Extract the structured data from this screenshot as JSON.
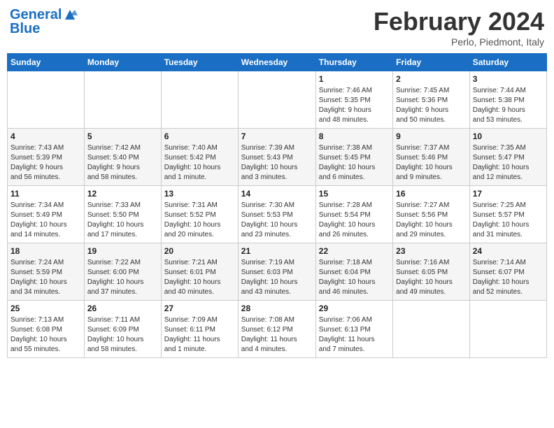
{
  "header": {
    "logo_line1": "General",
    "logo_line2": "Blue",
    "month_title": "February 2024",
    "location": "Perlo, Piedmont, Italy"
  },
  "weekdays": [
    "Sunday",
    "Monday",
    "Tuesday",
    "Wednesday",
    "Thursday",
    "Friday",
    "Saturday"
  ],
  "weeks": [
    [
      {
        "day": "",
        "info": ""
      },
      {
        "day": "",
        "info": ""
      },
      {
        "day": "",
        "info": ""
      },
      {
        "day": "",
        "info": ""
      },
      {
        "day": "1",
        "info": "Sunrise: 7:46 AM\nSunset: 5:35 PM\nDaylight: 9 hours\nand 48 minutes."
      },
      {
        "day": "2",
        "info": "Sunrise: 7:45 AM\nSunset: 5:36 PM\nDaylight: 9 hours\nand 50 minutes."
      },
      {
        "day": "3",
        "info": "Sunrise: 7:44 AM\nSunset: 5:38 PM\nDaylight: 9 hours\nand 53 minutes."
      }
    ],
    [
      {
        "day": "4",
        "info": "Sunrise: 7:43 AM\nSunset: 5:39 PM\nDaylight: 9 hours\nand 56 minutes."
      },
      {
        "day": "5",
        "info": "Sunrise: 7:42 AM\nSunset: 5:40 PM\nDaylight: 9 hours\nand 58 minutes."
      },
      {
        "day": "6",
        "info": "Sunrise: 7:40 AM\nSunset: 5:42 PM\nDaylight: 10 hours\nand 1 minute."
      },
      {
        "day": "7",
        "info": "Sunrise: 7:39 AM\nSunset: 5:43 PM\nDaylight: 10 hours\nand 3 minutes."
      },
      {
        "day": "8",
        "info": "Sunrise: 7:38 AM\nSunset: 5:45 PM\nDaylight: 10 hours\nand 6 minutes."
      },
      {
        "day": "9",
        "info": "Sunrise: 7:37 AM\nSunset: 5:46 PM\nDaylight: 10 hours\nand 9 minutes."
      },
      {
        "day": "10",
        "info": "Sunrise: 7:35 AM\nSunset: 5:47 PM\nDaylight: 10 hours\nand 12 minutes."
      }
    ],
    [
      {
        "day": "11",
        "info": "Sunrise: 7:34 AM\nSunset: 5:49 PM\nDaylight: 10 hours\nand 14 minutes."
      },
      {
        "day": "12",
        "info": "Sunrise: 7:33 AM\nSunset: 5:50 PM\nDaylight: 10 hours\nand 17 minutes."
      },
      {
        "day": "13",
        "info": "Sunrise: 7:31 AM\nSunset: 5:52 PM\nDaylight: 10 hours\nand 20 minutes."
      },
      {
        "day": "14",
        "info": "Sunrise: 7:30 AM\nSunset: 5:53 PM\nDaylight: 10 hours\nand 23 minutes."
      },
      {
        "day": "15",
        "info": "Sunrise: 7:28 AM\nSunset: 5:54 PM\nDaylight: 10 hours\nand 26 minutes."
      },
      {
        "day": "16",
        "info": "Sunrise: 7:27 AM\nSunset: 5:56 PM\nDaylight: 10 hours\nand 29 minutes."
      },
      {
        "day": "17",
        "info": "Sunrise: 7:25 AM\nSunset: 5:57 PM\nDaylight: 10 hours\nand 31 minutes."
      }
    ],
    [
      {
        "day": "18",
        "info": "Sunrise: 7:24 AM\nSunset: 5:59 PM\nDaylight: 10 hours\nand 34 minutes."
      },
      {
        "day": "19",
        "info": "Sunrise: 7:22 AM\nSunset: 6:00 PM\nDaylight: 10 hours\nand 37 minutes."
      },
      {
        "day": "20",
        "info": "Sunrise: 7:21 AM\nSunset: 6:01 PM\nDaylight: 10 hours\nand 40 minutes."
      },
      {
        "day": "21",
        "info": "Sunrise: 7:19 AM\nSunset: 6:03 PM\nDaylight: 10 hours\nand 43 minutes."
      },
      {
        "day": "22",
        "info": "Sunrise: 7:18 AM\nSunset: 6:04 PM\nDaylight: 10 hours\nand 46 minutes."
      },
      {
        "day": "23",
        "info": "Sunrise: 7:16 AM\nSunset: 6:05 PM\nDaylight: 10 hours\nand 49 minutes."
      },
      {
        "day": "24",
        "info": "Sunrise: 7:14 AM\nSunset: 6:07 PM\nDaylight: 10 hours\nand 52 minutes."
      }
    ],
    [
      {
        "day": "25",
        "info": "Sunrise: 7:13 AM\nSunset: 6:08 PM\nDaylight: 10 hours\nand 55 minutes."
      },
      {
        "day": "26",
        "info": "Sunrise: 7:11 AM\nSunset: 6:09 PM\nDaylight: 10 hours\nand 58 minutes."
      },
      {
        "day": "27",
        "info": "Sunrise: 7:09 AM\nSunset: 6:11 PM\nDaylight: 11 hours\nand 1 minute."
      },
      {
        "day": "28",
        "info": "Sunrise: 7:08 AM\nSunset: 6:12 PM\nDaylight: 11 hours\nand 4 minutes."
      },
      {
        "day": "29",
        "info": "Sunrise: 7:06 AM\nSunset: 6:13 PM\nDaylight: 11 hours\nand 7 minutes."
      },
      {
        "day": "",
        "info": ""
      },
      {
        "day": "",
        "info": ""
      }
    ]
  ]
}
